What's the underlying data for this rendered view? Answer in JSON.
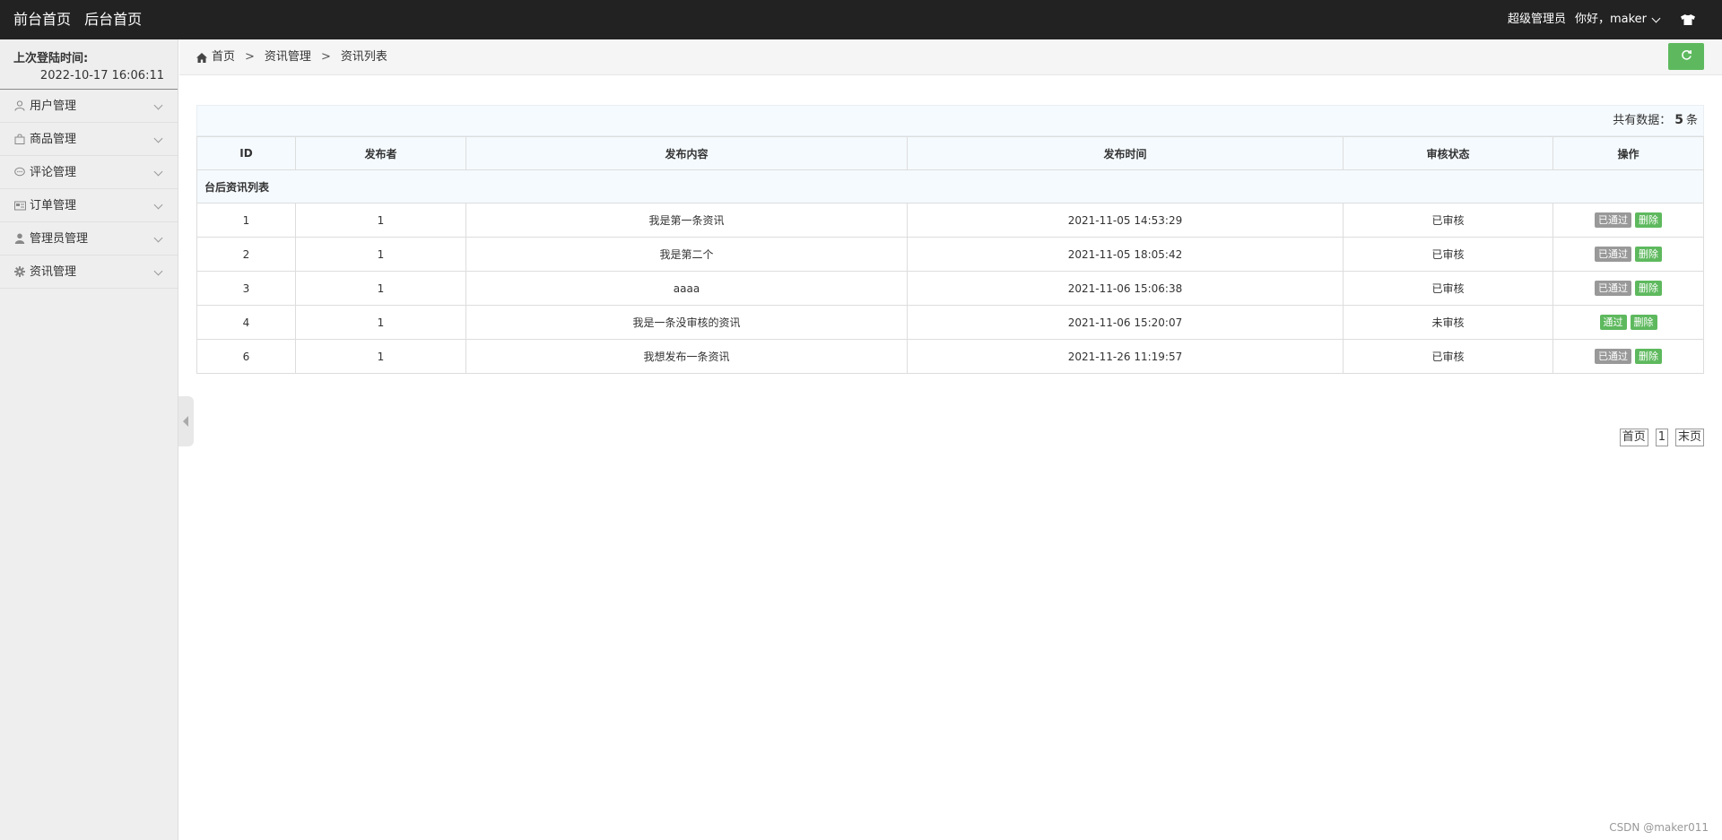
{
  "navbar": {
    "front_home": "前台首页",
    "back_home": "后台首页",
    "role": "超级管理员",
    "greeting": "你好，maker"
  },
  "sidebar": {
    "last_login_label": "上次登陆时间:",
    "last_login_time": "2022-10-17 16:06:11",
    "items": [
      {
        "label": "用户管理",
        "icon": "user-icon"
      },
      {
        "label": "商品管理",
        "icon": "shopping-bag-icon"
      },
      {
        "label": "评论管理",
        "icon": "comment-icon"
      },
      {
        "label": "订单管理",
        "icon": "order-card-icon"
      },
      {
        "label": "管理员管理",
        "icon": "admin-user-icon"
      },
      {
        "label": "资讯管理",
        "icon": "gear-icon"
      }
    ]
  },
  "breadcrumb": {
    "home": "首页",
    "sep": ">",
    "level1": "资讯管理",
    "level2": "资讯列表"
  },
  "count": {
    "label": "共有数据：",
    "value": "5",
    "unit": "条"
  },
  "table": {
    "caption": "台后资讯列表",
    "headers": [
      "ID",
      "发布者",
      "发布内容",
      "发布时间",
      "审核状态",
      "操作"
    ],
    "rows": [
      {
        "id": "1",
        "publisher": "1",
        "content": "我是第一条资讯",
        "time": "2021-11-05 14:53:29",
        "status": "已审核",
        "action": "已通过",
        "delete": "删除"
      },
      {
        "id": "2",
        "publisher": "1",
        "content": "我是第二个",
        "time": "2021-11-05 18:05:42",
        "status": "已审核",
        "action": "已通过",
        "delete": "删除"
      },
      {
        "id": "3",
        "publisher": "1",
        "content": "aaaa",
        "time": "2021-11-06 15:06:38",
        "status": "已审核",
        "action": "已通过",
        "delete": "删除"
      },
      {
        "id": "4",
        "publisher": "1",
        "content": "我是一条没审核的资讯",
        "time": "2021-11-06 15:20:07",
        "status": "未审核",
        "action": "通过",
        "delete": "删除"
      },
      {
        "id": "6",
        "publisher": "1",
        "content": "我想发布一条资讯",
        "time": "2021-11-26 11:19:57",
        "status": "已审核",
        "action": "已通过",
        "delete": "删除"
      }
    ]
  },
  "pager": {
    "first": "首页",
    "page": "1",
    "last": "末页"
  },
  "watermark": "CSDN @maker011",
  "colors": {
    "navbar_bg": "#222222",
    "accent_green": "#5eb95e",
    "passed_gray": "#999999",
    "header_bg": "#f5fafe"
  }
}
